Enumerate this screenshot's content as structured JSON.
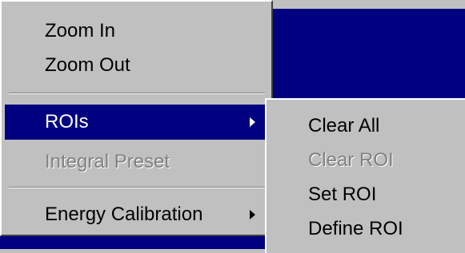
{
  "context_menu": {
    "items": [
      {
        "label": "Zoom In",
        "enabled": true
      },
      {
        "label": "Zoom Out",
        "enabled": true
      },
      {
        "label": "ROIs",
        "enabled": true,
        "selected": true,
        "submenu": true
      },
      {
        "label": "Integral Preset",
        "enabled": false
      },
      {
        "label": "Energy Calibration",
        "enabled": true,
        "submenu": true
      }
    ]
  },
  "roi_submenu": {
    "items": [
      {
        "label": "Clear All",
        "enabled": true
      },
      {
        "label": "Clear ROI",
        "enabled": false
      },
      {
        "label": "Set ROI",
        "enabled": true
      },
      {
        "label": "Define ROI",
        "enabled": true
      }
    ]
  },
  "colors": {
    "menu_background": "#c0c0c0",
    "highlight": "#000080",
    "disabled_text": "#808080",
    "text": "#000000"
  }
}
